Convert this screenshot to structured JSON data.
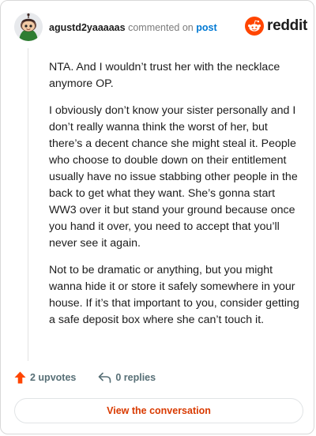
{
  "comment": {
    "username": "agustd2yaaaaas",
    "commented_on_text": "commented on",
    "post_link_text": "post",
    "paragraphs": [
      "NTA. And I wouldn’t trust her with the necklace anymore OP.",
      "I obviously don’t know your sister personally and I don’t really wanna think the worst of her, but there’s a decent chance she might steal it. People who choose to double down on their entitlement usually have no issue stabbing other people in the back to get what they want. She’s gonna start WW3 over it but stand your ground because once you hand it over, you need to accept that you’ll never see it again.",
      "Not to be dramatic or anything, but you might wanna hide it or store it safely somewhere in your house. If it’s that important to you, consider getting a safe deposit box where she can’t touch it."
    ]
  },
  "brand": {
    "logo_text": "reddit",
    "icon": "reddit-snoo-icon",
    "color": "#ff4500"
  },
  "actions": {
    "upvotes_label": "2 upvotes",
    "upvote_icon": "upvote-arrow-icon",
    "upvote_color": "#ff4500",
    "replies_label": "0 replies",
    "reply_icon": "reply-arrow-icon"
  },
  "cta": {
    "label": "View the conversation",
    "color": "#d93a00"
  }
}
